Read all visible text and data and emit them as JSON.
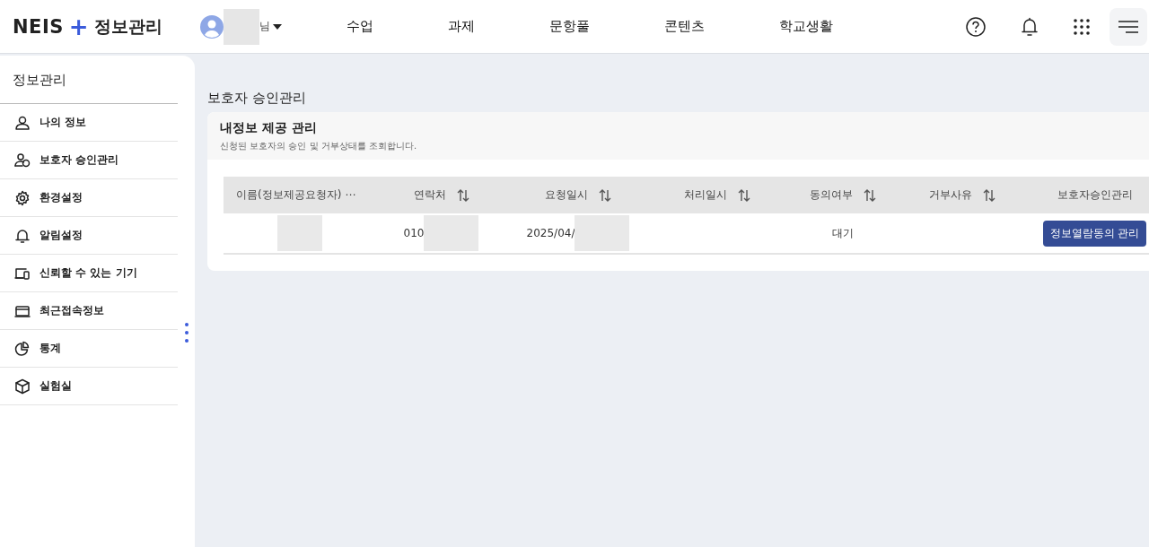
{
  "header": {
    "logo": {
      "brand": "NEIS",
      "plus": "+",
      "title": "정보관리"
    },
    "user": {
      "suffix": "님"
    },
    "nav": [
      {
        "label": "수업"
      },
      {
        "label": "과제"
      },
      {
        "label": "문항풀"
      },
      {
        "label": "콘텐츠"
      },
      {
        "label": "학교생활"
      }
    ]
  },
  "sidebar": {
    "title": "정보관리",
    "items": [
      {
        "label": "나의 정보"
      },
      {
        "label": "보호자 승인관리"
      },
      {
        "label": "환경설정"
      },
      {
        "label": "알림설정"
      },
      {
        "label": "신뢰할 수 있는 기기"
      },
      {
        "label": "최근접속정보"
      },
      {
        "label": "통계"
      },
      {
        "label": "실험실"
      }
    ]
  },
  "page_title": "보호자 승인관리",
  "card": {
    "title": "내정보 제공 관리",
    "subtitle": "신청된 보호자의 승인 및 거부상태를 조회합니다.",
    "table": {
      "columns": [
        {
          "label": "이름(정보제공요청자) ⋯",
          "sortable": false
        },
        {
          "label": "연락처",
          "sortable": true
        },
        {
          "label": "요청일시",
          "sortable": true
        },
        {
          "label": "처리일시",
          "sortable": true
        },
        {
          "label": "동의여부",
          "sortable": true
        },
        {
          "label": "거부사유",
          "sortable": true
        },
        {
          "label": "보호자승인관리",
          "sortable": false
        }
      ],
      "rows": [
        {
          "cells": [
            {
              "kind": "redacted"
            },
            {
              "kind": "partial",
              "text": "010"
            },
            {
              "kind": "partial",
              "text": "2025/04/"
            },
            {
              "kind": "empty"
            },
            {
              "kind": "text",
              "text": "대기"
            },
            {
              "kind": "empty"
            },
            {
              "kind": "button",
              "text": "정보열람동의 관리"
            }
          ]
        }
      ]
    }
  }
}
